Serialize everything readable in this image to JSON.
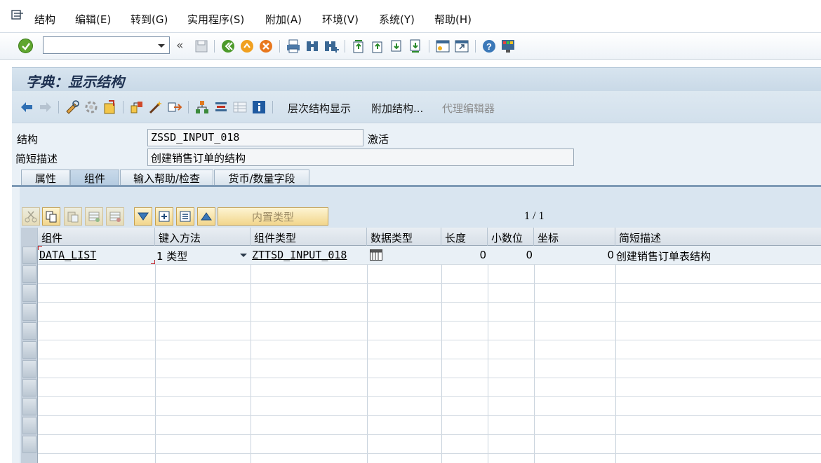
{
  "menu": {
    "items": [
      "结构",
      "编辑(E)",
      "转到(G)",
      "实用程序(S)",
      "附加(A)",
      "环境(V)",
      "系统(Y)",
      "帮助(H)"
    ]
  },
  "toolbar": {
    "command_value": "",
    "back_symbol": "«"
  },
  "title": "字典：显示结构",
  "app_toolbar": {
    "hierarchy_display": "层次结构显示",
    "append_structure": "附加结构...",
    "proxy_editor": "代理编辑器"
  },
  "header_fields": {
    "structure_label": "结构",
    "structure_value": "ZSSD_INPUT_018",
    "status": "激活",
    "short_desc_label": "简短描述",
    "short_desc_value": "创建销售订单的结构"
  },
  "tabs": [
    "属性",
    "组件",
    "输入帮助/检查",
    "货币/数量字段"
  ],
  "active_tab": "组件",
  "table_toolbar": {
    "builtin_type_button": "内置类型",
    "pager": "1 / 1"
  },
  "grid": {
    "columns": [
      "组件",
      "键入方法",
      "组件类型",
      "数据类型",
      "长度",
      "小数位",
      "坐标",
      "简短描述"
    ],
    "rows": [
      {
        "component": "DATA_LIST",
        "typing_method": "1 类型",
        "component_type": "ZTTSD_INPUT_018",
        "data_type_icon": "table-type-icon",
        "length": "0",
        "decimals": "0",
        "coordinate": "0",
        "description": "创建销售订单表结构"
      }
    ]
  },
  "colors": {
    "title_bg": "#c9d9e7",
    "panel_bg": "#d9e5f0",
    "button_gold": "#f2d68c",
    "ok_green": "#5fa62f"
  }
}
